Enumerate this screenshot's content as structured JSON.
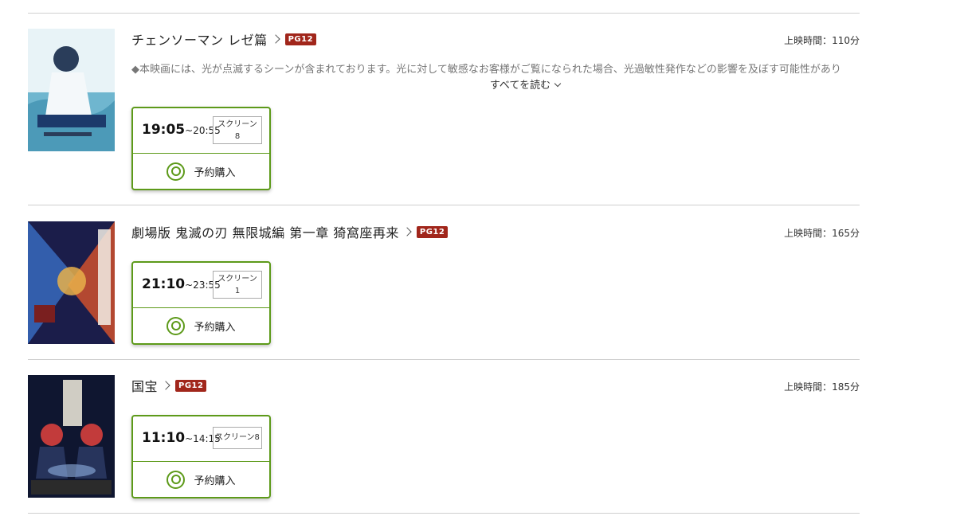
{
  "movies": [
    {
      "title": "チェンソーマン レゼ篇",
      "rating": "PG12",
      "runtime": "上映時間：110分",
      "notice": "◆本映画には、光が点滅するシーンが含まれております。光に対して敏感なお客様がご覧になられた場合、光過敏性発作などの影響を及ぼす可能性があり",
      "read_more": "すべてを読む",
      "showtime": {
        "start": "19:05",
        "end": "~20:55",
        "screen_line1": "スクリーン",
        "screen_line2": "8",
        "buy": "予約購入"
      },
      "poster_colors": [
        "#6fb6cf",
        "#e8f3f7",
        "#2a3d5a"
      ]
    },
    {
      "title": "劇場版 鬼滅の刃 無限城編 第一章 猗窩座再来",
      "rating": "PG12",
      "runtime": "上映時間：165分",
      "showtime": {
        "start": "21:10",
        "end": "~23:55",
        "screen_line1": "スクリーン",
        "screen_line2": "1",
        "buy": "予約購入"
      },
      "poster_colors": [
        "#1b1d4a",
        "#d9542a",
        "#3d7ad6"
      ]
    },
    {
      "title": "国宝",
      "rating": "PG12",
      "runtime": "上映時間：185分",
      "showtime": {
        "start": "11:10",
        "end": "~14:15",
        "screen": "スクリーン8",
        "buy": "予約購入"
      },
      "poster_colors": [
        "#0f1630",
        "#c23b3b",
        "#e6e1d5"
      ]
    }
  ],
  "colors": {
    "accent_green": "#5d9a1a",
    "rating_red": "#a1261b"
  }
}
